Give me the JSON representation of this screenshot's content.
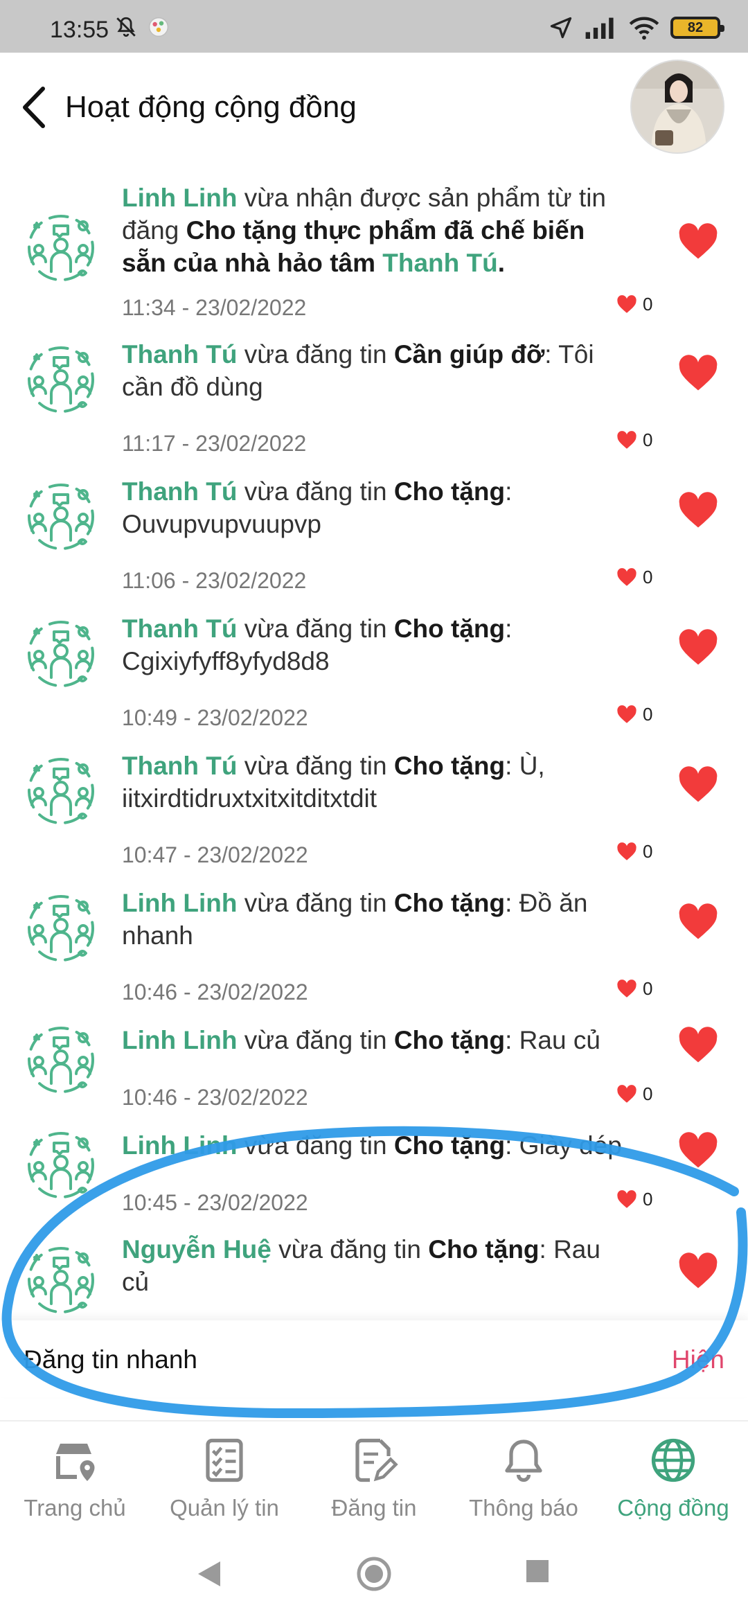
{
  "status_bar": {
    "time": "13:55",
    "battery": "82"
  },
  "header": {
    "title": "Hoạt động cộng đồng"
  },
  "feed": [
    {
      "user": "Linh Linh",
      "action": " vừa nhận được sản phẩm từ tin đăng  ",
      "post": "Cho tặng thực phẩm đã chế biến sẵn của nhà hảo tâm ",
      "extra_user": "Thanh Tú",
      "tail": ".",
      "time": "11:34 - 23/02/2022",
      "likes": "0"
    },
    {
      "user": "Thanh Tú",
      "action": " vừa đăng tin ",
      "category": "Cần giúp đỡ",
      "content": ": Tôi cần đồ dùng",
      "time": "11:17 - 23/02/2022",
      "likes": "0"
    },
    {
      "user": "Thanh Tú",
      "action": " vừa đăng tin ",
      "category": "Cho tặng",
      "content": ": Ouvupvupvuupvp",
      "time": "11:06 - 23/02/2022",
      "likes": "0"
    },
    {
      "user": "Thanh Tú",
      "action": " vừa đăng tin ",
      "category": "Cho tặng",
      "content": ": Cgixiyfyff8yfyd8d8",
      "time": "10:49 - 23/02/2022",
      "likes": "0"
    },
    {
      "user": "Thanh Tú",
      "action": " vừa đăng tin ",
      "category": "Cho tặng",
      "content": ": Ù, iitxirdtidruxtxitxitditxtdit",
      "time": "10:47 - 23/02/2022",
      "likes": "0"
    },
    {
      "user": "Linh Linh",
      "action": " vừa đăng tin ",
      "category": "Cho tặng",
      "content": ": Đồ ăn nhanh",
      "time": "10:46 - 23/02/2022",
      "likes": "0"
    },
    {
      "user": "Linh Linh",
      "action": " vừa đăng tin ",
      "category": "Cho tặng",
      "content": ": Rau củ",
      "time": "10:46 - 23/02/2022",
      "likes": "0"
    },
    {
      "user": "Linh Linh",
      "action": " vừa đăng tin ",
      "category": "Cho tặng",
      "content": ": Giày dép",
      "time": "10:45 - 23/02/2022",
      "likes": "0"
    },
    {
      "user": "Nguyễn Huệ",
      "action": " vừa đăng tin ",
      "category": "Cho tặng",
      "content": ": Rau củ",
      "time": "",
      "likes": ""
    }
  ],
  "quick_post": {
    "label": "Đăng tin nhanh",
    "toggle": "Hiện"
  },
  "nav": {
    "home": "Trang chủ",
    "manage": "Quản lý tin",
    "post": "Đăng tin",
    "notify": "Thông báo",
    "community": "Cộng đồng"
  },
  "colors": {
    "accent": "#3fa37d",
    "heart": "#f23b3b",
    "toggle": "#e0466c",
    "annotation": "#2f9be8"
  }
}
